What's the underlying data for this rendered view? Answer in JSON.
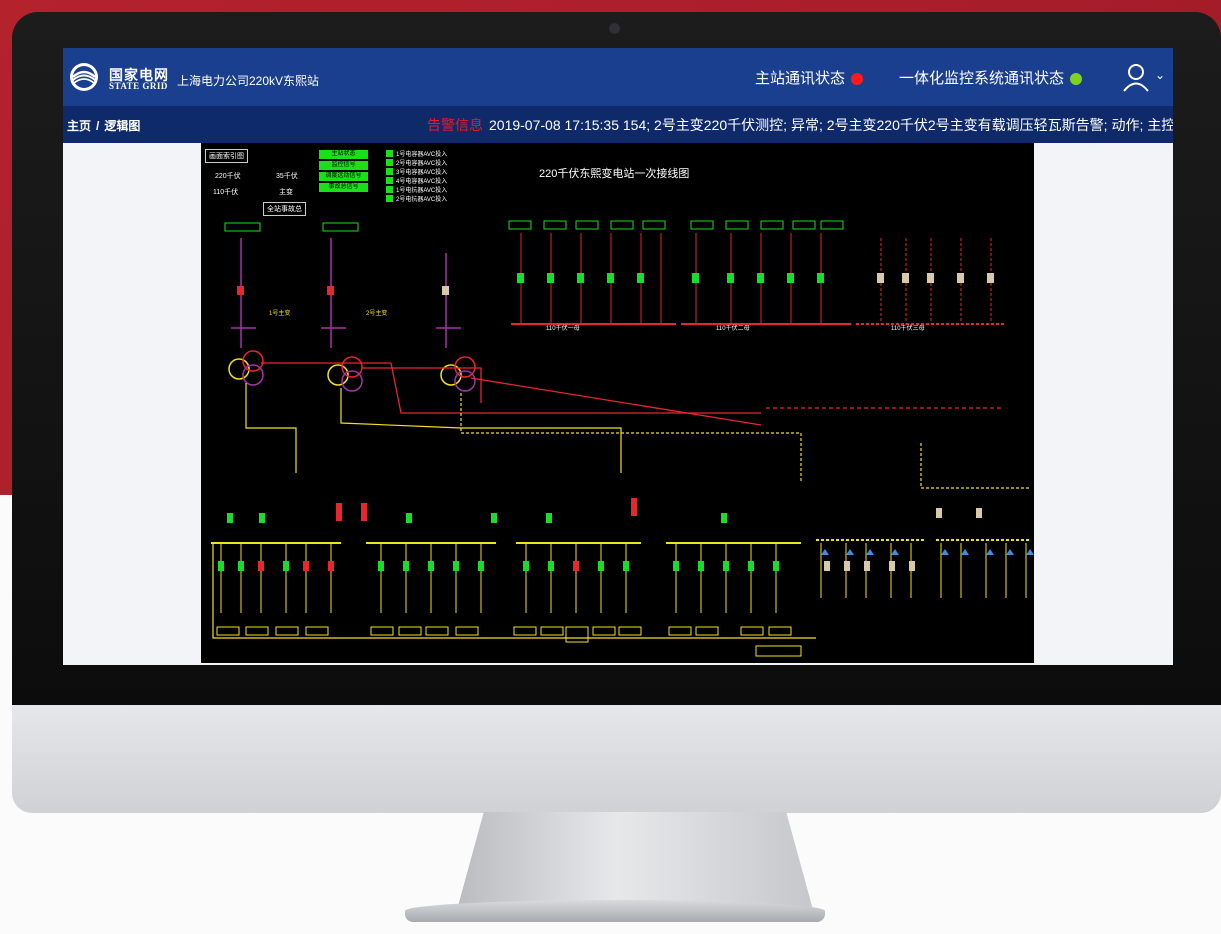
{
  "app": {
    "brand_cn": "国家电网",
    "brand_en": "STATE GRID",
    "station_name": "上海电力公司220kV东熙站",
    "logo_icon": "state-grid-logo"
  },
  "header": {
    "status_main": "主站通讯状态",
    "status_main_color": "#ff1a1a",
    "status_integrated": "一体化监控系统通讯状态",
    "status_integrated_color": "#7ed321",
    "user_icon": "user-icon"
  },
  "breadcrumb": {
    "home": "主页",
    "separator": "/",
    "current": "逻辑图"
  },
  "alarm": {
    "label": "告警信息",
    "message": "2019-07-08 17:15:35 154; 2号主变220千伏测控; 异常; 2号主变220千伏2号主变有载调压轻瓦斯告警; 动作; 主控"
  },
  "diagram": {
    "title": "220千伏东熙变电站一次接线图",
    "index_button": "画面索引图",
    "nav": {
      "v220": "220千伏",
      "v35": "35千伏",
      "v110": "110千伏",
      "main_tx": "主变",
      "total_accident": "全站事故总"
    },
    "green_buttons": [
      "主站状态",
      "监控信号",
      "调度远动信号",
      "事故总信号"
    ],
    "avc_items": [
      "1号电容器AVC投入",
      "2号电容器AVC投入",
      "3号电容器AVC投入",
      "4号电容器AVC投入",
      "1号电抗器AVC投入",
      "2号电抗器AVC投入"
    ],
    "bus_labels": {
      "b110_1": "110千伏一母",
      "b110_2": "110千伏二母",
      "b110_3": "110千伏三母",
      "tx1": "1号主变",
      "tx2": "2号主变"
    },
    "colors": {
      "v220": "#a632a6",
      "v110": "#e8262e",
      "v35": "#f2e21c",
      "closed": "#1adc2a",
      "open": "#e8262e",
      "green_label": "#1adc2a"
    }
  }
}
